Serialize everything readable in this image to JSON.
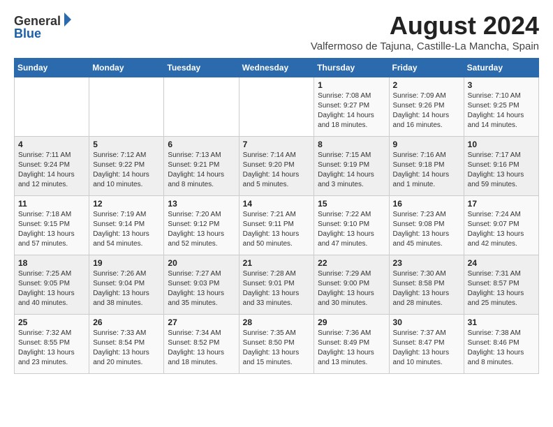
{
  "logo": {
    "general": "General",
    "blue": "Blue"
  },
  "header": {
    "title": "August 2024",
    "subtitle": "Valfermoso de Tajuna, Castille-La Mancha, Spain"
  },
  "weekdays": [
    "Sunday",
    "Monday",
    "Tuesday",
    "Wednesday",
    "Thursday",
    "Friday",
    "Saturday"
  ],
  "weeks": [
    [
      {
        "day": "",
        "info": ""
      },
      {
        "day": "",
        "info": ""
      },
      {
        "day": "",
        "info": ""
      },
      {
        "day": "",
        "info": ""
      },
      {
        "day": "1",
        "info": "Sunrise: 7:08 AM\nSunset: 9:27 PM\nDaylight: 14 hours\nand 18 minutes."
      },
      {
        "day": "2",
        "info": "Sunrise: 7:09 AM\nSunset: 9:26 PM\nDaylight: 14 hours\nand 16 minutes."
      },
      {
        "day": "3",
        "info": "Sunrise: 7:10 AM\nSunset: 9:25 PM\nDaylight: 14 hours\nand 14 minutes."
      }
    ],
    [
      {
        "day": "4",
        "info": "Sunrise: 7:11 AM\nSunset: 9:24 PM\nDaylight: 14 hours\nand 12 minutes."
      },
      {
        "day": "5",
        "info": "Sunrise: 7:12 AM\nSunset: 9:22 PM\nDaylight: 14 hours\nand 10 minutes."
      },
      {
        "day": "6",
        "info": "Sunrise: 7:13 AM\nSunset: 9:21 PM\nDaylight: 14 hours\nand 8 minutes."
      },
      {
        "day": "7",
        "info": "Sunrise: 7:14 AM\nSunset: 9:20 PM\nDaylight: 14 hours\nand 5 minutes."
      },
      {
        "day": "8",
        "info": "Sunrise: 7:15 AM\nSunset: 9:19 PM\nDaylight: 14 hours\nand 3 minutes."
      },
      {
        "day": "9",
        "info": "Sunrise: 7:16 AM\nSunset: 9:18 PM\nDaylight: 14 hours\nand 1 minute."
      },
      {
        "day": "10",
        "info": "Sunrise: 7:17 AM\nSunset: 9:16 PM\nDaylight: 13 hours\nand 59 minutes."
      }
    ],
    [
      {
        "day": "11",
        "info": "Sunrise: 7:18 AM\nSunset: 9:15 PM\nDaylight: 13 hours\nand 57 minutes."
      },
      {
        "day": "12",
        "info": "Sunrise: 7:19 AM\nSunset: 9:14 PM\nDaylight: 13 hours\nand 54 minutes."
      },
      {
        "day": "13",
        "info": "Sunrise: 7:20 AM\nSunset: 9:12 PM\nDaylight: 13 hours\nand 52 minutes."
      },
      {
        "day": "14",
        "info": "Sunrise: 7:21 AM\nSunset: 9:11 PM\nDaylight: 13 hours\nand 50 minutes."
      },
      {
        "day": "15",
        "info": "Sunrise: 7:22 AM\nSunset: 9:10 PM\nDaylight: 13 hours\nand 47 minutes."
      },
      {
        "day": "16",
        "info": "Sunrise: 7:23 AM\nSunset: 9:08 PM\nDaylight: 13 hours\nand 45 minutes."
      },
      {
        "day": "17",
        "info": "Sunrise: 7:24 AM\nSunset: 9:07 PM\nDaylight: 13 hours\nand 42 minutes."
      }
    ],
    [
      {
        "day": "18",
        "info": "Sunrise: 7:25 AM\nSunset: 9:05 PM\nDaylight: 13 hours\nand 40 minutes."
      },
      {
        "day": "19",
        "info": "Sunrise: 7:26 AM\nSunset: 9:04 PM\nDaylight: 13 hours\nand 38 minutes."
      },
      {
        "day": "20",
        "info": "Sunrise: 7:27 AM\nSunset: 9:03 PM\nDaylight: 13 hours\nand 35 minutes."
      },
      {
        "day": "21",
        "info": "Sunrise: 7:28 AM\nSunset: 9:01 PM\nDaylight: 13 hours\nand 33 minutes."
      },
      {
        "day": "22",
        "info": "Sunrise: 7:29 AM\nSunset: 9:00 PM\nDaylight: 13 hours\nand 30 minutes."
      },
      {
        "day": "23",
        "info": "Sunrise: 7:30 AM\nSunset: 8:58 PM\nDaylight: 13 hours\nand 28 minutes."
      },
      {
        "day": "24",
        "info": "Sunrise: 7:31 AM\nSunset: 8:57 PM\nDaylight: 13 hours\nand 25 minutes."
      }
    ],
    [
      {
        "day": "25",
        "info": "Sunrise: 7:32 AM\nSunset: 8:55 PM\nDaylight: 13 hours\nand 23 minutes."
      },
      {
        "day": "26",
        "info": "Sunrise: 7:33 AM\nSunset: 8:54 PM\nDaylight: 13 hours\nand 20 minutes."
      },
      {
        "day": "27",
        "info": "Sunrise: 7:34 AM\nSunset: 8:52 PM\nDaylight: 13 hours\nand 18 minutes."
      },
      {
        "day": "28",
        "info": "Sunrise: 7:35 AM\nSunset: 8:50 PM\nDaylight: 13 hours\nand 15 minutes."
      },
      {
        "day": "29",
        "info": "Sunrise: 7:36 AM\nSunset: 8:49 PM\nDaylight: 13 hours\nand 13 minutes."
      },
      {
        "day": "30",
        "info": "Sunrise: 7:37 AM\nSunset: 8:47 PM\nDaylight: 13 hours\nand 10 minutes."
      },
      {
        "day": "31",
        "info": "Sunrise: 7:38 AM\nSunset: 8:46 PM\nDaylight: 13 hours\nand 8 minutes."
      }
    ]
  ]
}
